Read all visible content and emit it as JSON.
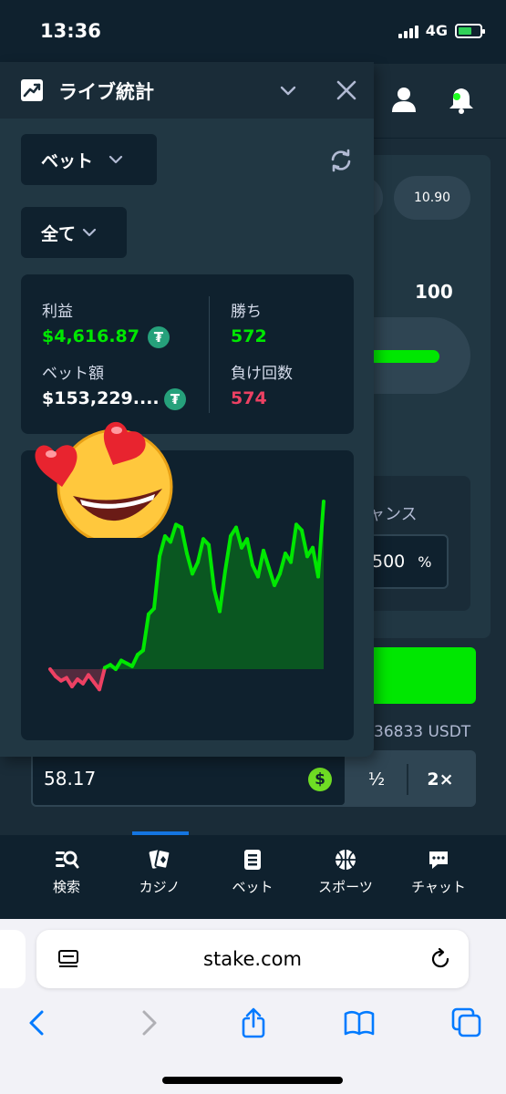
{
  "status_bar": {
    "time": "13:36",
    "network": "4G"
  },
  "game": {
    "multiplier_chip": "10.90",
    "range_max": "100",
    "chance_label": "ャンス",
    "chance_value": "500",
    "chance_unit": "%",
    "balance_text": "36833 USDT",
    "bet_amount": "58.17",
    "coin_symbol": "$",
    "half_label": "½",
    "double_label": "2×"
  },
  "live_stats": {
    "title": "ライブ統計",
    "filter_bet": "ベット",
    "filter_all": "全て",
    "stats": {
      "profit_label": "利益",
      "profit_value": "$4,616.87",
      "wagered_label": "ベット額",
      "wagered_value": "$153,229....",
      "wins_label": "勝ち",
      "wins_value": "572",
      "losses_label": "負け回数",
      "losses_value": "574"
    },
    "currency_symbol": "₮"
  },
  "colors": {
    "profit_green": "#00e701",
    "loss_red": "#ed4163",
    "panel_bg": "#213743",
    "card_bg": "#0f212e",
    "tether": "#26a17b"
  },
  "chart_data": {
    "type": "area",
    "title": "",
    "xlabel": "",
    "ylabel": "",
    "x": [
      0,
      1,
      2,
      3,
      4,
      5,
      6,
      7,
      8,
      9,
      10,
      11,
      12,
      13,
      14,
      15,
      16,
      17,
      18,
      19,
      20,
      21,
      22,
      23,
      24,
      25,
      26,
      27,
      28,
      29,
      30,
      31,
      32,
      33,
      34,
      35,
      36,
      37,
      38,
      39,
      40,
      41,
      42,
      43,
      44,
      45,
      46,
      47,
      48,
      49,
      50
    ],
    "values": [
      0,
      -5,
      -8,
      -6,
      -12,
      -7,
      -10,
      -4,
      -9,
      -14,
      1,
      3,
      0,
      6,
      4,
      2,
      10,
      13,
      38,
      42,
      78,
      92,
      88,
      100,
      98,
      80,
      66,
      74,
      90,
      86,
      55,
      40,
      68,
      92,
      98,
      84,
      90,
      72,
      64,
      82,
      70,
      58,
      66,
      80,
      74,
      100,
      96,
      78,
      84,
      64,
      116
    ],
    "series_colors": {
      "positive": "#00e701",
      "negative": "#ed4163"
    }
  },
  "tab_bar": [
    {
      "label": "検索",
      "icon": "search-icon"
    },
    {
      "label": "カジノ",
      "icon": "casino-cards-icon"
    },
    {
      "label": "ベット",
      "icon": "bet-slip-icon"
    },
    {
      "label": "スポーツ",
      "icon": "basketball-icon"
    },
    {
      "label": "チャット",
      "icon": "chat-icon"
    }
  ],
  "browser": {
    "url": "stake.com"
  }
}
